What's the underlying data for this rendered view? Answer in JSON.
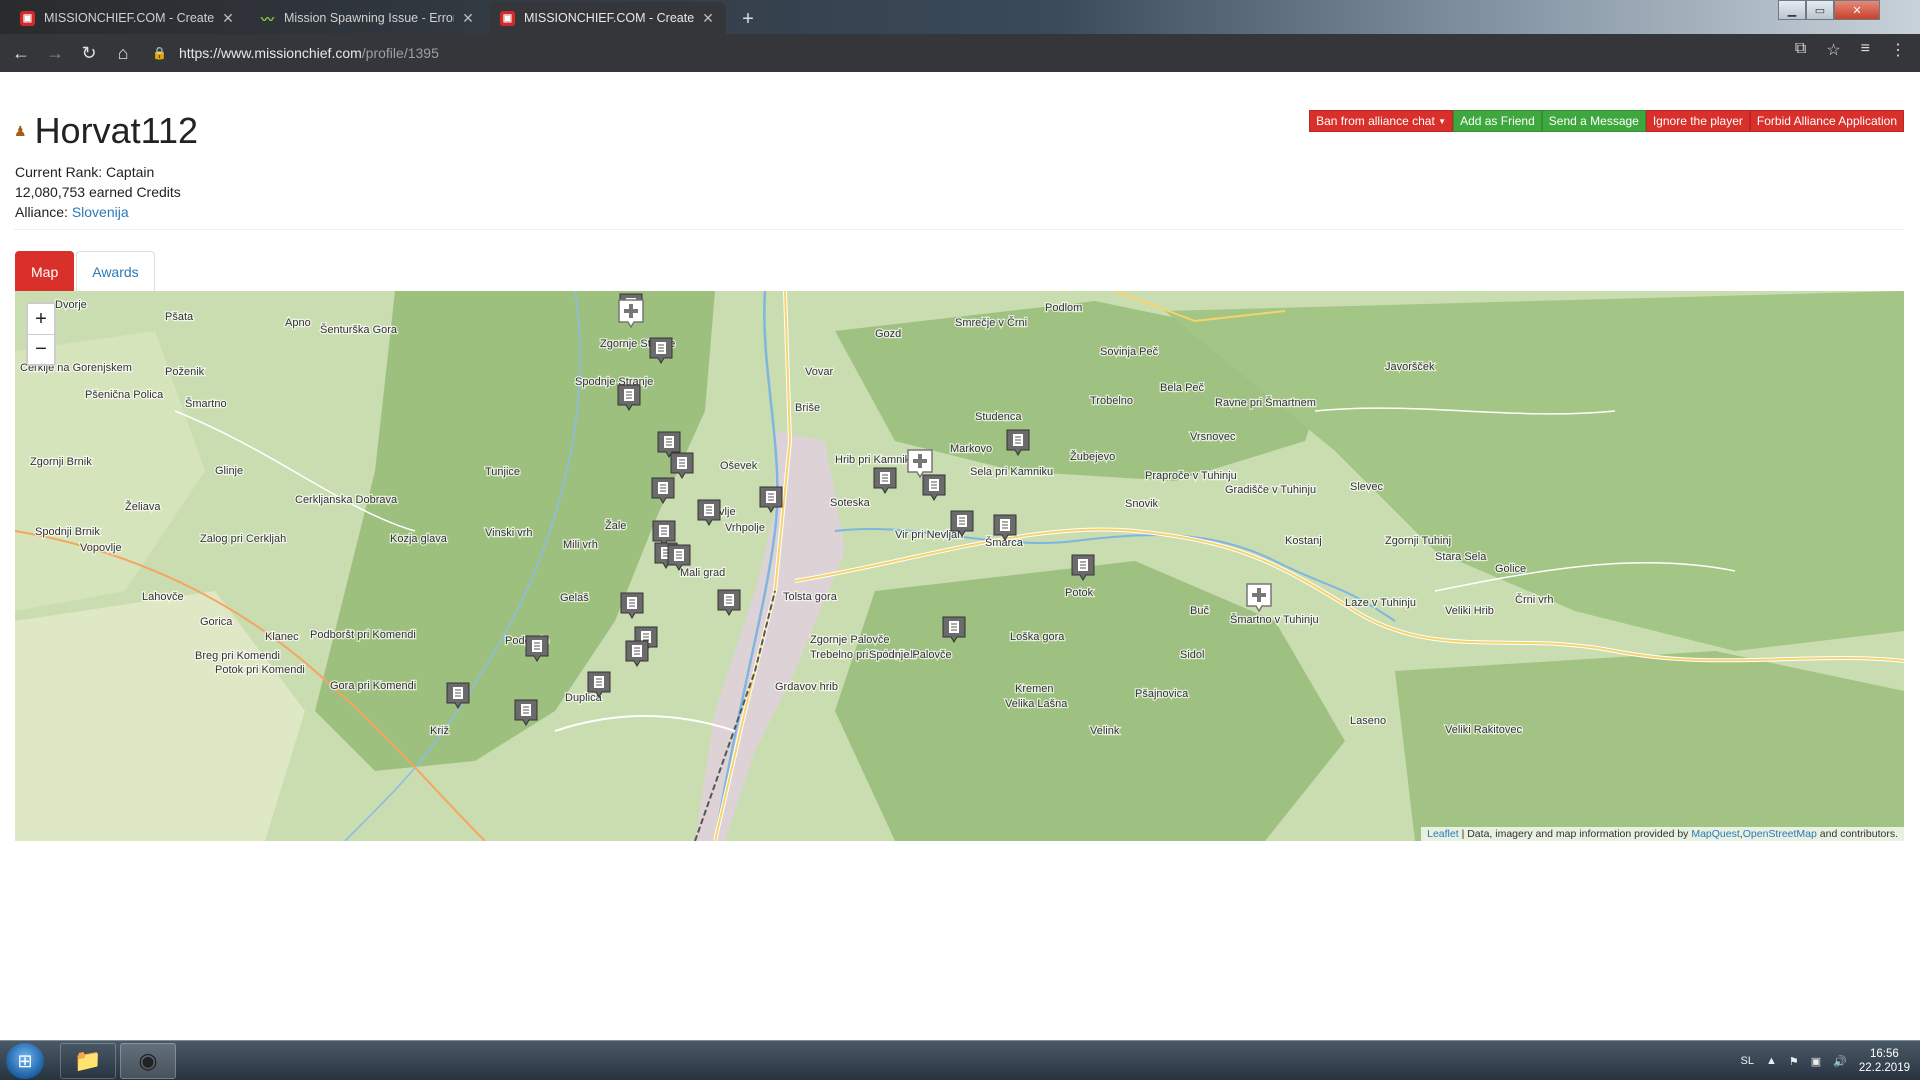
{
  "browser": {
    "tabs": [
      {
        "title": "MISSIONCHIEF.COM - Create yo",
        "favicon": "missionchief-icon",
        "active": false
      },
      {
        "title": "Mission Spawning Issue - Errors,",
        "favicon": "forum-icon",
        "active": false
      },
      {
        "title": "MISSIONCHIEF.COM - Create yo",
        "favicon": "missionchief-icon",
        "active": true
      }
    ],
    "url_host": "https://www.missionchief.com",
    "url_path": "/profile/1395"
  },
  "profile": {
    "name": "Horvat112",
    "rank_label": "Current Rank: Captain",
    "credits_label": "12,080,753 earned Credits",
    "alliance_label": "Alliance:",
    "alliance_name": "Slovenija"
  },
  "actions": {
    "ban": "Ban from alliance chat",
    "add_friend": "Add as Friend",
    "message": "Send a Message",
    "ignore": "Ignore the player",
    "forbid": "Forbid Alliance Application"
  },
  "page_tabs": {
    "map": "Map",
    "awards": "Awards"
  },
  "map": {
    "zoom_in": "+",
    "zoom_out": "−",
    "attribution_leaflet": "Leaflet",
    "attribution_text": "| Data, imagery and map information provided by",
    "attribution_mapquest": "MapQuest",
    "attribution_osm": "OpenStreetMap",
    "attribution_end": "and contributors.",
    "places": [
      "Dvorje",
      "Pšata",
      "Apno",
      "Šenturška Gora",
      "Podlom",
      "Gozd",
      "Smrečje v Črni",
      "Zgornje Stranje",
      "Sovinja Peč",
      "Javoršček",
      "Cerklje na Gorenjskem",
      "Poženik",
      "Spodnje Stranje",
      "Vovar",
      "Bela Peč",
      "Pšenična Polica",
      "Šmartno",
      "Briše",
      "Studenca",
      "Trobelno",
      "Ravne pri Šmartnem",
      "Zgornji Brnik",
      "Glinje",
      "Tunjice",
      "Oševek",
      "Hrib pri Kamniku",
      "Markovo",
      "Žubejevo",
      "Vrsnovec",
      "Praproče v Tuhinju",
      "Sela pri Kamniku",
      "Cerkljanska Dobrava",
      "Nevlje",
      "Soteska",
      "Snovik",
      "Slevec",
      "Gradišče v Tuhinju",
      "Želiava",
      "Spodnji Brnik",
      "Žale",
      "Vrhpolje",
      "Vir pri Nevljah",
      "Kostanj",
      "Zgornji Tuhinj",
      "Zalog pri Cerkljah",
      "Kozja glava",
      "Vinski vrh",
      "Šmarca",
      "Stara Sela",
      "Golice",
      "Vopovlje",
      "Mili vrh",
      "Mali grad",
      "Potok",
      "Lahovče",
      "Gelaš",
      "Tolsta gora",
      "Laze v Tuhinju",
      "Črni vrh",
      "Klanec",
      "Podboršt pri Komendi",
      "Gorica",
      "Zgornje Palovče",
      "Loška gora",
      "Šmartno v Tuhinju",
      "Buč",
      "Veliki Hrib",
      "Breg pri Komendi",
      "Podgorje",
      "Trebelno pri Palovčah",
      "Spodnje Palovče",
      "Sidol",
      "Potok pri Komendi",
      "Gora pri Komendi",
      "Grdavov hrib",
      "Kremen",
      "Velika Lašna",
      "Pšajnovica",
      "Duplica",
      "Laseno",
      "Križ",
      "Velink",
      "Veliki Rakitovec"
    ]
  },
  "taskbar": {
    "lang": "SL",
    "time": "16:56",
    "date": "22.2.2019"
  }
}
